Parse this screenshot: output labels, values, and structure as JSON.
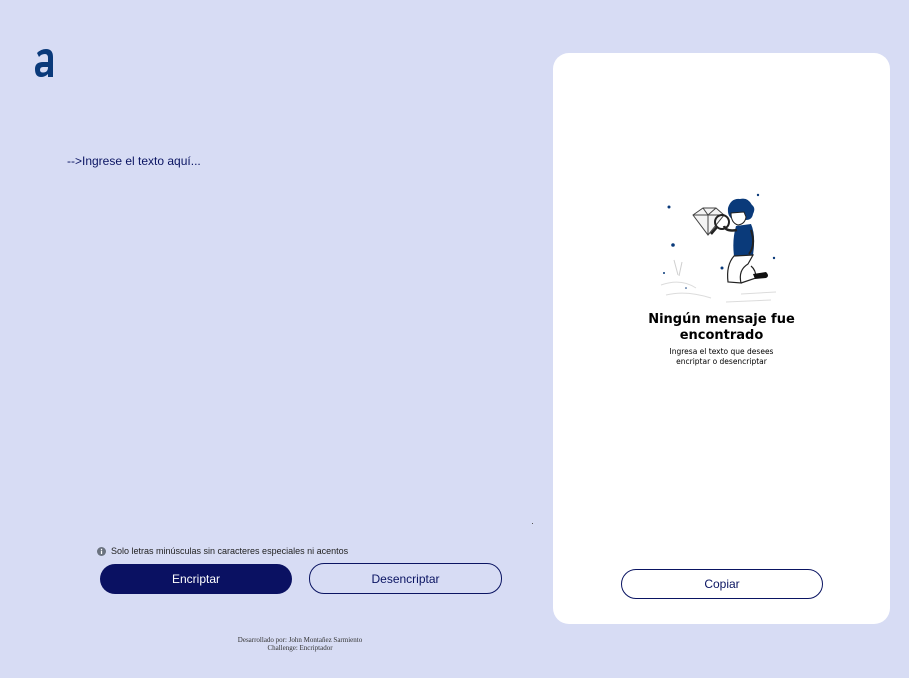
{
  "app": {
    "logo_icon": "alura-a-logo-icon"
  },
  "input": {
    "placeholder": "-->Ingrese el texto aquí..."
  },
  "hint": {
    "icon": "info-icon",
    "text": "Solo letras minúsculas sin caracteres especiales ni acentos"
  },
  "buttons": {
    "encrypt_label": "Encriptar",
    "decrypt_label": "Desencriptar",
    "copy_label": "Copiar"
  },
  "footer": {
    "line1": "Desarrollado por: John Montañez Sarmiento",
    "line2": "Challenge: Encriptador"
  },
  "output_panel": {
    "illustration_icon": "person-with-magnifier-illustration",
    "title_line1": "Ningún mensaje fue",
    "title_line2": "encontrado",
    "subtitle_line1": "Ingresa el texto que desees",
    "subtitle_line2": "encriptar o desencriptar"
  },
  "colors": {
    "background": "#d7dcf4",
    "primary": "#0a1162",
    "panel": "#ffffff"
  }
}
